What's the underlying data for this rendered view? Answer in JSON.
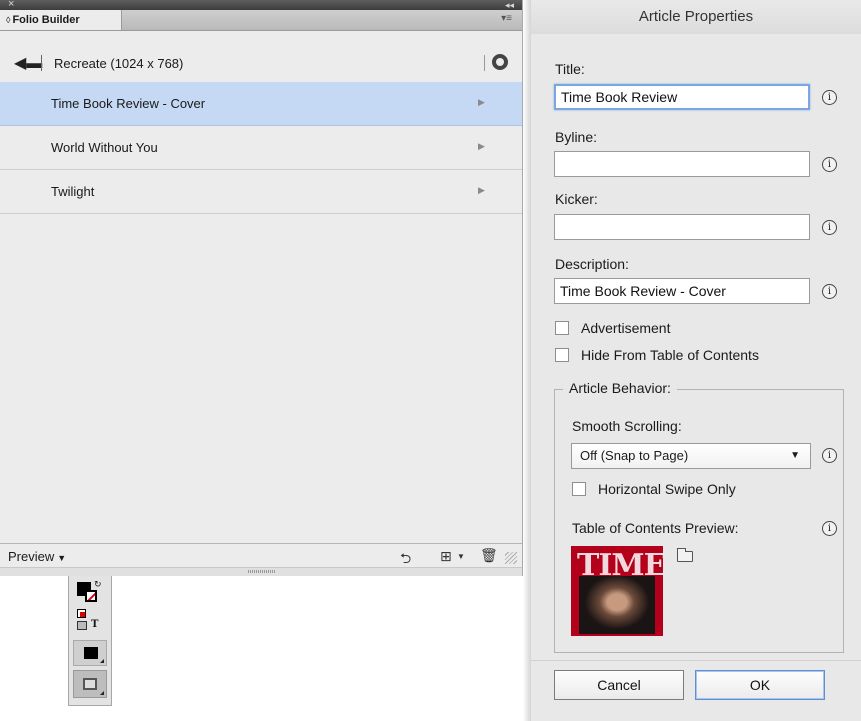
{
  "folio_panel": {
    "tab_title": "Folio Builder",
    "nav_title": "Recreate  (1024 x 768)",
    "articles": [
      {
        "label": "Time Book Review - Cover",
        "selected": true
      },
      {
        "label": "World Without You",
        "selected": false
      },
      {
        "label": "Twilight",
        "selected": false
      }
    ],
    "footer": {
      "preview_label": "Preview"
    }
  },
  "dialog": {
    "title": "Article Properties",
    "fields": {
      "title_label": "Title:",
      "title_value": "Time Book Review",
      "byline_label": "Byline:",
      "byline_value": "",
      "kicker_label": "Kicker:",
      "kicker_value": "",
      "description_label": "Description:",
      "description_value": "Time Book Review - Cover"
    },
    "checkboxes": {
      "advertisement_label": "Advertisement",
      "advertisement_checked": false,
      "hide_toc_label": "Hide From Table of Contents",
      "hide_toc_checked": false
    },
    "behavior": {
      "group_label": "Article Behavior:",
      "smooth_scrolling_label": "Smooth Scrolling:",
      "smooth_scrolling_value": "Off (Snap to Page)",
      "horizontal_swipe_label": "Horizontal Swipe Only",
      "horizontal_swipe_checked": false,
      "toc_preview_label": "Table of Contents Preview:",
      "toc_thumb_text": "TIME"
    },
    "buttons": {
      "cancel": "Cancel",
      "ok": "OK"
    }
  },
  "icons": {
    "back": "back-arrow-icon",
    "settings": "settings-icon",
    "info": "info-icon",
    "folder": "folder-icon",
    "trash": "trash-icon"
  },
  "colors": {
    "selection": "#c6d9f4",
    "focus_ring": "#7aa7e0",
    "ok_border": "#5e8fd0"
  }
}
